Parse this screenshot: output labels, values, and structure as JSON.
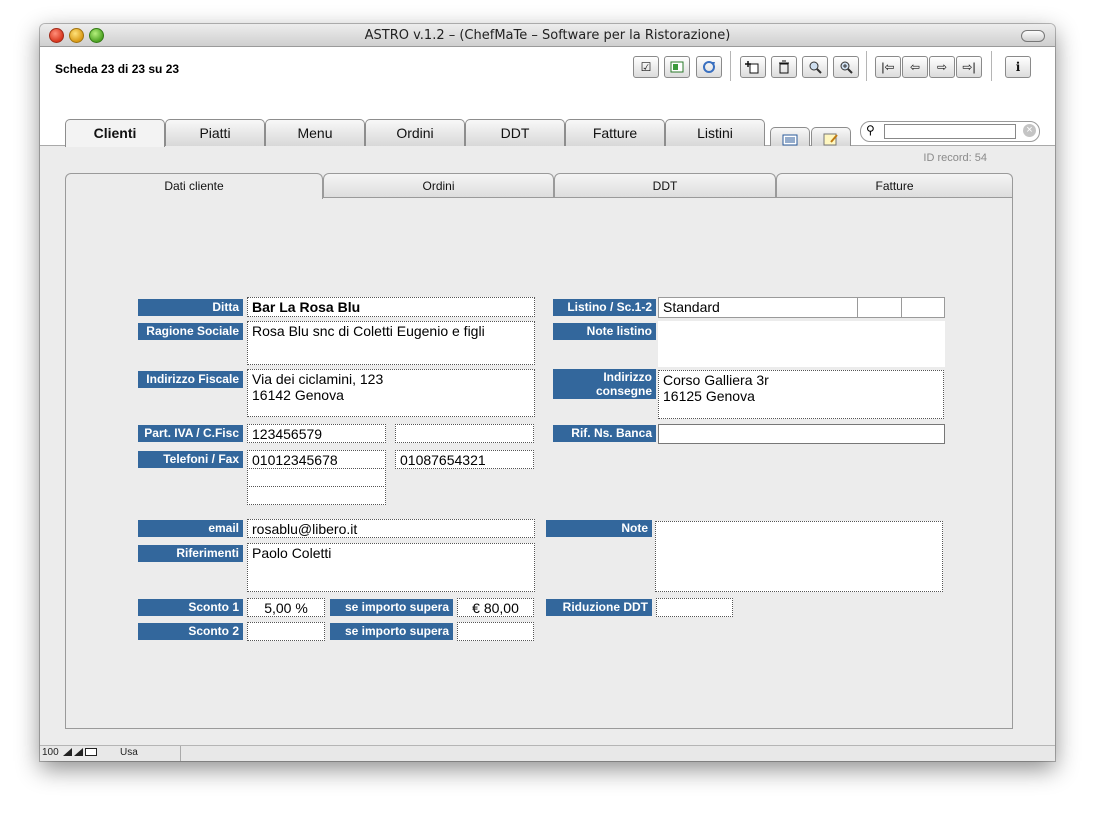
{
  "window": {
    "title": "ASTRO  v.1.2 – (ChefMaTe – Software per la Ristorazione)"
  },
  "toolbar": {
    "record_count": "Scheda 23 di 23 su 23",
    "icons": [
      "checkbox-icon",
      "export-icon",
      "refresh-icon",
      "new-record-icon",
      "trash-icon",
      "find-icon",
      "zoom-icon",
      "first-record-icon",
      "prev-record-icon",
      "next-record-icon",
      "last-record-icon",
      "info-icon"
    ]
  },
  "tabs": [
    "Clienti",
    "Piatti",
    "Menu",
    "Ordini",
    "DDT",
    "Fatture",
    "Listini"
  ],
  "search": {
    "placeholder": ""
  },
  "id_record": "ID record: 54",
  "subtabs": [
    "Dati cliente",
    "Ordini",
    "DDT",
    "Fatture"
  ],
  "form": {
    "labels": {
      "ditta": "Ditta",
      "ragione_sociale": "Ragione Sociale",
      "indirizzo_fiscale": "Indirizzo Fiscale",
      "piva": "Part. IVA / C.Fisc",
      "telefoni": "Telefoni / Fax",
      "email": "email",
      "riferimenti": "Riferimenti",
      "sconto1": "Sconto 1",
      "sconto2": "Sconto 2",
      "se_importo1": "se importo supera",
      "se_importo2": "se importo supera",
      "listino": "Listino / Sc.1-2",
      "note_listino": "Note listino",
      "indirizzo_consegne_1": "Indirizzo",
      "indirizzo_consegne_2": "consegne",
      "rif_banca": "Rif. Ns. Banca",
      "note": "Note",
      "riduzione_ddt": "Riduzione DDT"
    },
    "values": {
      "ditta": "Bar La Rosa Blu",
      "ragione_sociale": "Rosa Blu snc di Coletti Eugenio e figli",
      "indirizzo_fiscale": "Via dei ciclamini, 123\n16142 Genova",
      "piva": "123456579",
      "cf": "",
      "telefono": "01012345678",
      "fax": "01087654321",
      "tel2": "",
      "tel3": "",
      "email": "rosablu@libero.it",
      "riferimenti": "Paolo Coletti",
      "sconto1": "5,00 %",
      "importo1": "€ 80,00",
      "sconto2": "",
      "importo2": "",
      "listino": "Standard",
      "sc1": "",
      "sc2": "",
      "note_listino": "",
      "indirizzo_consegne": "Corso Galliera 3r\n16125 Genova",
      "rif_banca": "",
      "note": "",
      "riduzione_ddt": ""
    }
  },
  "statusbar": {
    "zoom": "100",
    "mode": "Usa"
  }
}
